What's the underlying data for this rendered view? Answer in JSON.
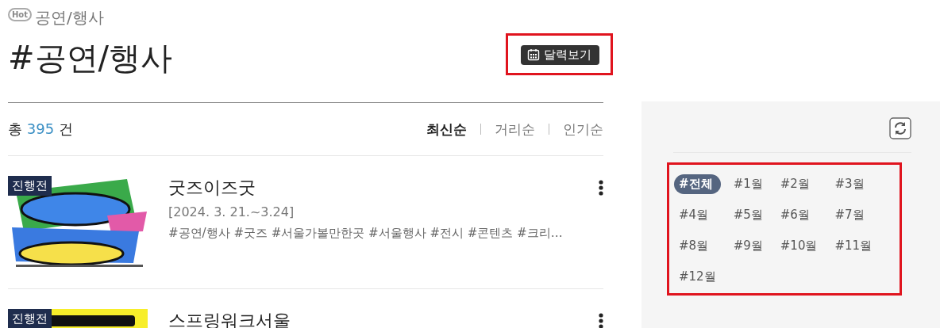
{
  "category": {
    "badge": "Hot",
    "label": "공연/행사"
  },
  "title": "#공연/행사",
  "calendar_button": "달력보기",
  "total": {
    "prefix": "총",
    "count": "395",
    "suffix": "건"
  },
  "sort_options": [
    {
      "label": "최신순",
      "selected": true
    },
    {
      "label": "거리순",
      "selected": false
    },
    {
      "label": "인기순",
      "selected": false
    }
  ],
  "events": [
    {
      "status": "진행전",
      "title": "굿즈이즈굿",
      "date": "[2024. 3. 21.~3.24]",
      "tags": "#공연/행사 #굿즈 #서울가볼만한곳 #서울행사 #전시 #콘텐츠 #크리…"
    },
    {
      "status": "진행전",
      "title": "스프링워크서울"
    }
  ],
  "month_filters": [
    {
      "label": "#전체",
      "selected": true
    },
    {
      "label": "#1월",
      "selected": false
    },
    {
      "label": "#2월",
      "selected": false
    },
    {
      "label": "#3월",
      "selected": false
    },
    {
      "label": "#4월",
      "selected": false
    },
    {
      "label": "#5월",
      "selected": false
    },
    {
      "label": "#6월",
      "selected": false
    },
    {
      "label": "#7월",
      "selected": false
    },
    {
      "label": "#8월",
      "selected": false
    },
    {
      "label": "#9월",
      "selected": false
    },
    {
      "label": "#10월",
      "selected": false
    },
    {
      "label": "#11월",
      "selected": false
    },
    {
      "label": "#12월",
      "selected": false
    }
  ]
}
